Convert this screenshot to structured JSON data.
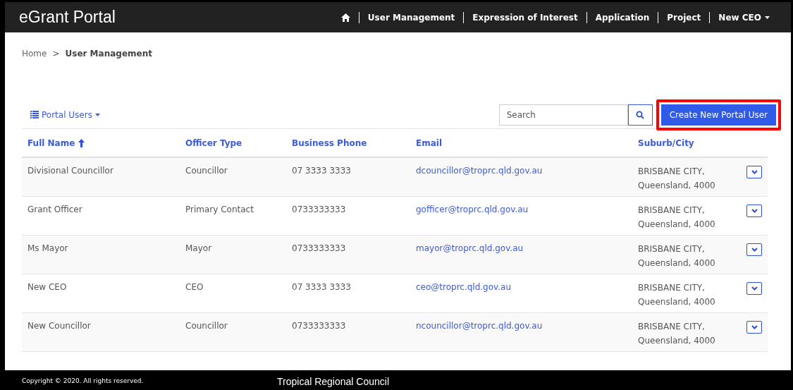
{
  "navbar": {
    "brand": "eGrant Portal",
    "items": [
      {
        "kind": "home"
      },
      {
        "kind": "link",
        "label": "User Management"
      },
      {
        "kind": "link",
        "label": "Expression of Interest"
      },
      {
        "kind": "link",
        "label": "Application"
      },
      {
        "kind": "link",
        "label": "Project"
      },
      {
        "kind": "dropdown",
        "label": "New CEO"
      }
    ]
  },
  "breadcrumb_separator": ">",
  "breadcrumb": [
    {
      "label": "Home",
      "current": false
    },
    {
      "label": "User Management",
      "current": true
    }
  ],
  "view_menu": {
    "label": "Portal Users"
  },
  "search": {
    "placeholder": "Search"
  },
  "create_button": {
    "label": "Create New Portal User",
    "highlighted": true
  },
  "table": {
    "columns": [
      {
        "label": "Full Name",
        "sorted": true
      },
      {
        "label": "Officer Type",
        "sorted": false
      },
      {
        "label": "Business Phone",
        "sorted": false
      },
      {
        "label": "Email",
        "sorted": false
      },
      {
        "label": "Suburb/City",
        "sorted": false
      }
    ],
    "rows": [
      {
        "full_name": "Divisional Councillor",
        "officer_type": "Councillor",
        "business_phone": "07 3333 3333",
        "email": "dcouncillor@troprc.qld.gov.au",
        "suburb": "BRISBANE CITY,",
        "state": "Queensland, 4000"
      },
      {
        "full_name": "Grant Officer",
        "officer_type": "Primary Contact",
        "business_phone": "0733333333",
        "email": "gofficer@troprc.qld.gov.au",
        "suburb": "BRISBANE CITY,",
        "state": "Queensland, 4000"
      },
      {
        "full_name": "Ms Mayor",
        "officer_type": "Mayor",
        "business_phone": "0733333333",
        "email": "mayor@troprc.qld.gov.au",
        "suburb": "BRISBANE CITY,",
        "state": "Queensland, 4000"
      },
      {
        "full_name": "New CEO",
        "officer_type": "CEO",
        "business_phone": "07 3333 3333",
        "email": "ceo@troprc.qld.gov.au",
        "suburb": "BRISBANE CITY,",
        "state": "Queensland, 4000"
      },
      {
        "full_name": "New Councillor",
        "officer_type": "Councillor",
        "business_phone": "0733333333",
        "email": "ncouncillor@troprc.qld.gov.au",
        "suburb": "BRISBANE CITY,",
        "state": "Queensland, 4000"
      }
    ]
  },
  "footer": {
    "copyright": "Copyright © 2020. All rights reserved.",
    "council": "Tropical Regional Council"
  }
}
